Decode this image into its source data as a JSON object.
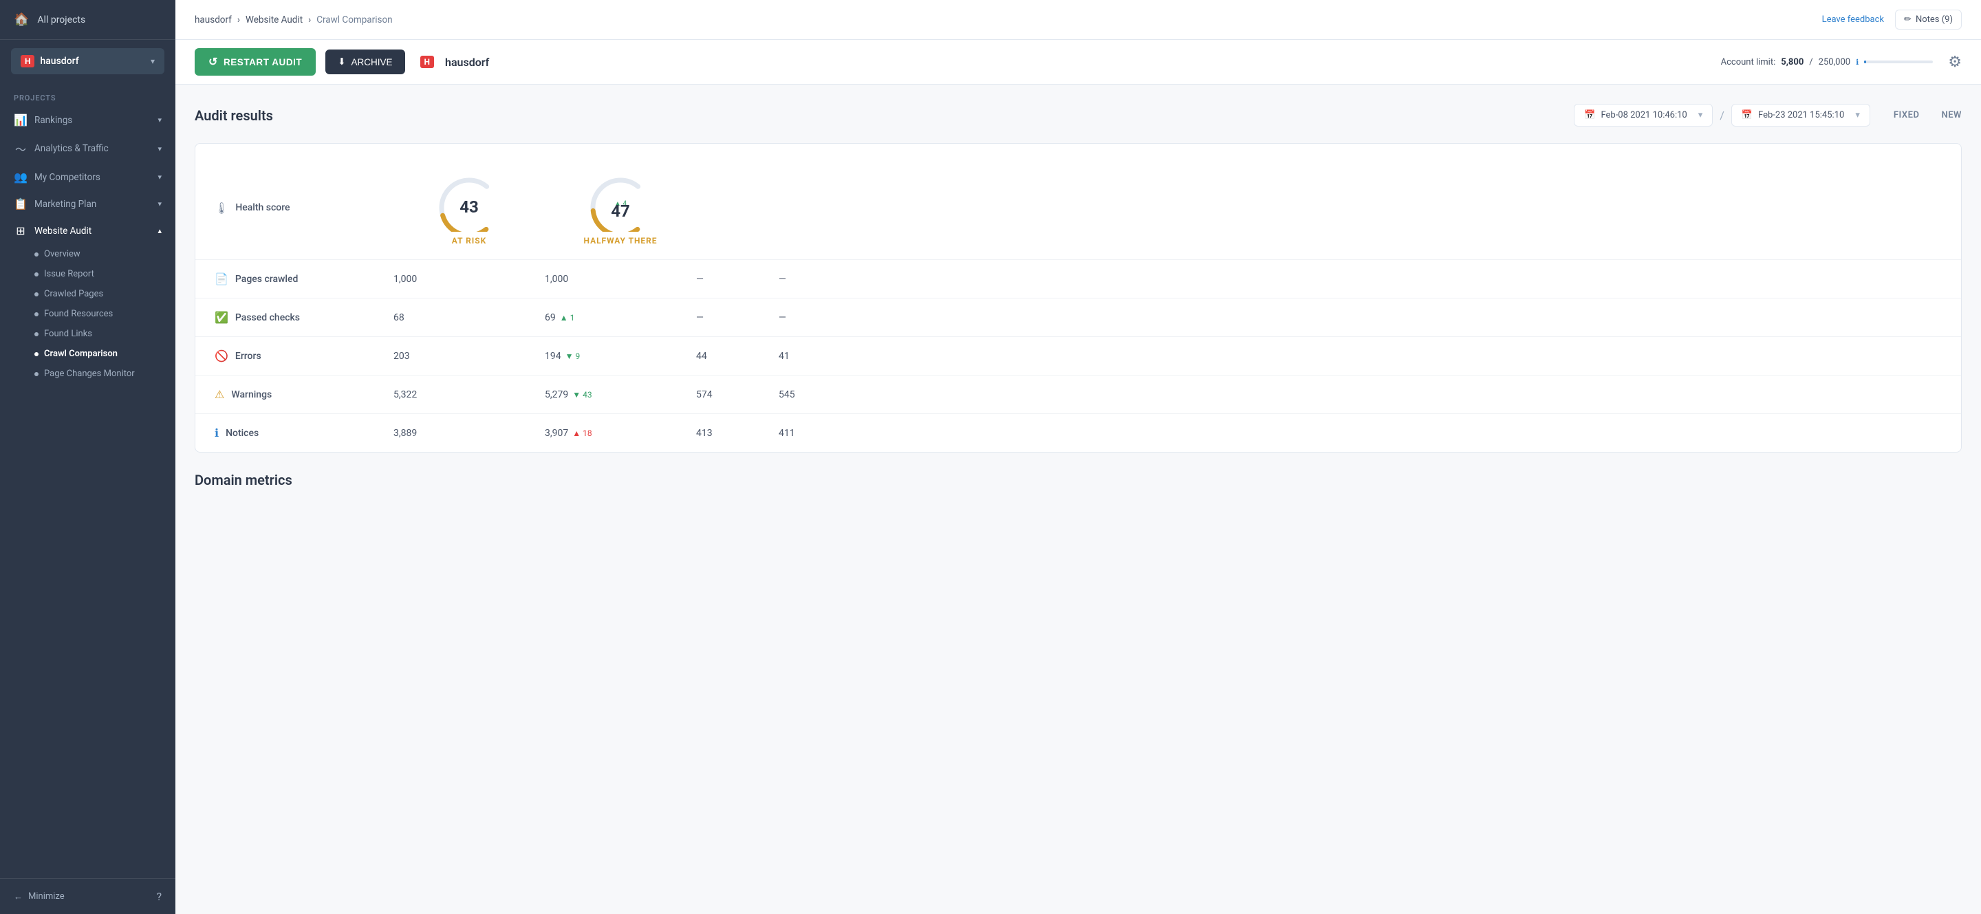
{
  "sidebar": {
    "all_projects": "All projects",
    "project_icon": "H",
    "project_name": "hausdorf",
    "sections": {
      "projects_label": "PROJECTS"
    },
    "nav_items": [
      {
        "id": "rankings",
        "icon": "📊",
        "label": "Rankings",
        "has_arrow": true
      },
      {
        "id": "analytics",
        "icon": "〜",
        "label": "Analytics & Traffic",
        "has_arrow": true
      },
      {
        "id": "competitors",
        "icon": "👥",
        "label": "My Competitors",
        "has_arrow": true
      },
      {
        "id": "marketing",
        "icon": "📋",
        "label": "Marketing Plan",
        "has_arrow": true
      },
      {
        "id": "website-audit",
        "icon": "🔍",
        "label": "Website Audit",
        "active": true,
        "has_arrow": true
      }
    ],
    "sub_items": [
      {
        "id": "overview",
        "label": "Overview"
      },
      {
        "id": "issue-report",
        "label": "Issue Report"
      },
      {
        "id": "crawled-pages",
        "label": "Crawled Pages"
      },
      {
        "id": "found-resources",
        "label": "Found Resources"
      },
      {
        "id": "found-links",
        "label": "Found Links"
      },
      {
        "id": "crawl-comparison",
        "label": "Crawl Comparison",
        "active": true
      },
      {
        "id": "page-changes-monitor",
        "label": "Page Changes Monitor"
      }
    ],
    "minimize_label": "Minimize"
  },
  "header": {
    "breadcrumb_home": "hausdorf",
    "breadcrumb_sep1": "›",
    "breadcrumb_item2": "Website Audit",
    "breadcrumb_sep2": "›",
    "breadcrumb_current": "Crawl Comparison",
    "leave_feedback": "Leave feedback",
    "notes_icon": "✏",
    "notes_label": "Notes (9)"
  },
  "toolbar": {
    "restart_icon": "↺",
    "restart_label": "RESTART AUDIT",
    "archive_icon": "⬇",
    "archive_label": "ARCHIVE",
    "project_icon": "H",
    "project_name": "hausdorf",
    "account_limit_label": "Account limit:",
    "account_used": "5,800",
    "account_sep": "/",
    "account_total": "250,000",
    "account_info": "ℹ",
    "settings_icon": "⚙"
  },
  "audit": {
    "title": "Audit results",
    "date1": "Feb-08 2021 10:46:10",
    "date1_icon": "📅",
    "date_sep": "/",
    "date2": "Feb-23 2021 15:45:10",
    "date2_icon": "📅",
    "fixed_label": "FIXED",
    "new_label": "NEW",
    "rows": [
      {
        "id": "health-score",
        "icon": "🌡",
        "label": "Health score",
        "val1": "43",
        "val1_status": "AT RISK",
        "val2": "47",
        "val2_change_dir": "up",
        "val2_change_color": "green",
        "val2_change_val": "4",
        "val2_status": "HALFWAY THERE",
        "fixed": "",
        "new": "",
        "is_score": true
      },
      {
        "id": "pages-crawled",
        "icon": "📄",
        "label": "Pages crawled",
        "val1": "1,000",
        "val2": "1,000",
        "val2_change_dir": "",
        "val2_change_val": "",
        "fixed": "—",
        "new": "—"
      },
      {
        "id": "passed-checks",
        "icon": "✅",
        "label": "Passed checks",
        "val1": "68",
        "val2": "69",
        "val2_change_dir": "up",
        "val2_change_color": "green",
        "val2_change_val": "1",
        "fixed": "—",
        "new": "—"
      },
      {
        "id": "errors",
        "icon": "🚫",
        "label": "Errors",
        "val1": "203",
        "val2": "194",
        "val2_change_dir": "down",
        "val2_change_color": "green",
        "val2_change_val": "9",
        "fixed": "44",
        "new": "41"
      },
      {
        "id": "warnings",
        "icon": "⚠",
        "label": "Warnings",
        "val1": "5,322",
        "val2": "5,279",
        "val2_change_dir": "down",
        "val2_change_color": "green",
        "val2_change_val": "43",
        "fixed": "574",
        "new": "545"
      },
      {
        "id": "notices",
        "icon": "ℹ",
        "label": "Notices",
        "val1": "3,889",
        "val2": "3,907",
        "val2_change_dir": "up",
        "val2_change_color": "red",
        "val2_change_val": "18",
        "fixed": "413",
        "new": "411"
      }
    ]
  },
  "domain": {
    "title": "Domain metrics"
  }
}
